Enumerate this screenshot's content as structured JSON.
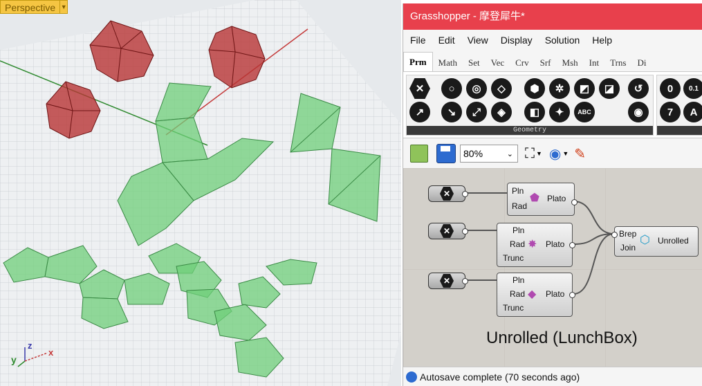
{
  "viewport": {
    "label": "Perspective",
    "axes": {
      "y": "y",
      "z": "z",
      "x": "x"
    }
  },
  "gh": {
    "title": "Grasshopper - 摩登犀牛*",
    "menu": [
      "File",
      "Edit",
      "View",
      "Display",
      "Solution",
      "Help"
    ],
    "tabs": [
      "Prm",
      "Math",
      "Set",
      "Vec",
      "Crv",
      "Srf",
      "Msh",
      "Int",
      "Trns",
      "Di"
    ],
    "panel_caption": "Geometry",
    "zoom": "80%",
    "components": {
      "plato1": {
        "inputs": [
          "Pln",
          "Rad"
        ],
        "output": "Plato"
      },
      "plato2": {
        "inputs": [
          "Pln",
          "Rad",
          "Trunc"
        ],
        "output": "Plato"
      },
      "plato3": {
        "inputs": [
          "Pln",
          "Rad",
          "Trunc"
        ],
        "output": "Plato"
      },
      "unroll": {
        "inputs": [
          "Brep",
          "Join"
        ],
        "output": "Unrolled"
      }
    },
    "group_label": "Unrolled (LunchBox)",
    "status": "Autosave complete (70 seconds ago)"
  },
  "colors": {
    "title_bar": "#e8404c",
    "solid": "#b83434",
    "unfold": "#6fcf7a"
  }
}
